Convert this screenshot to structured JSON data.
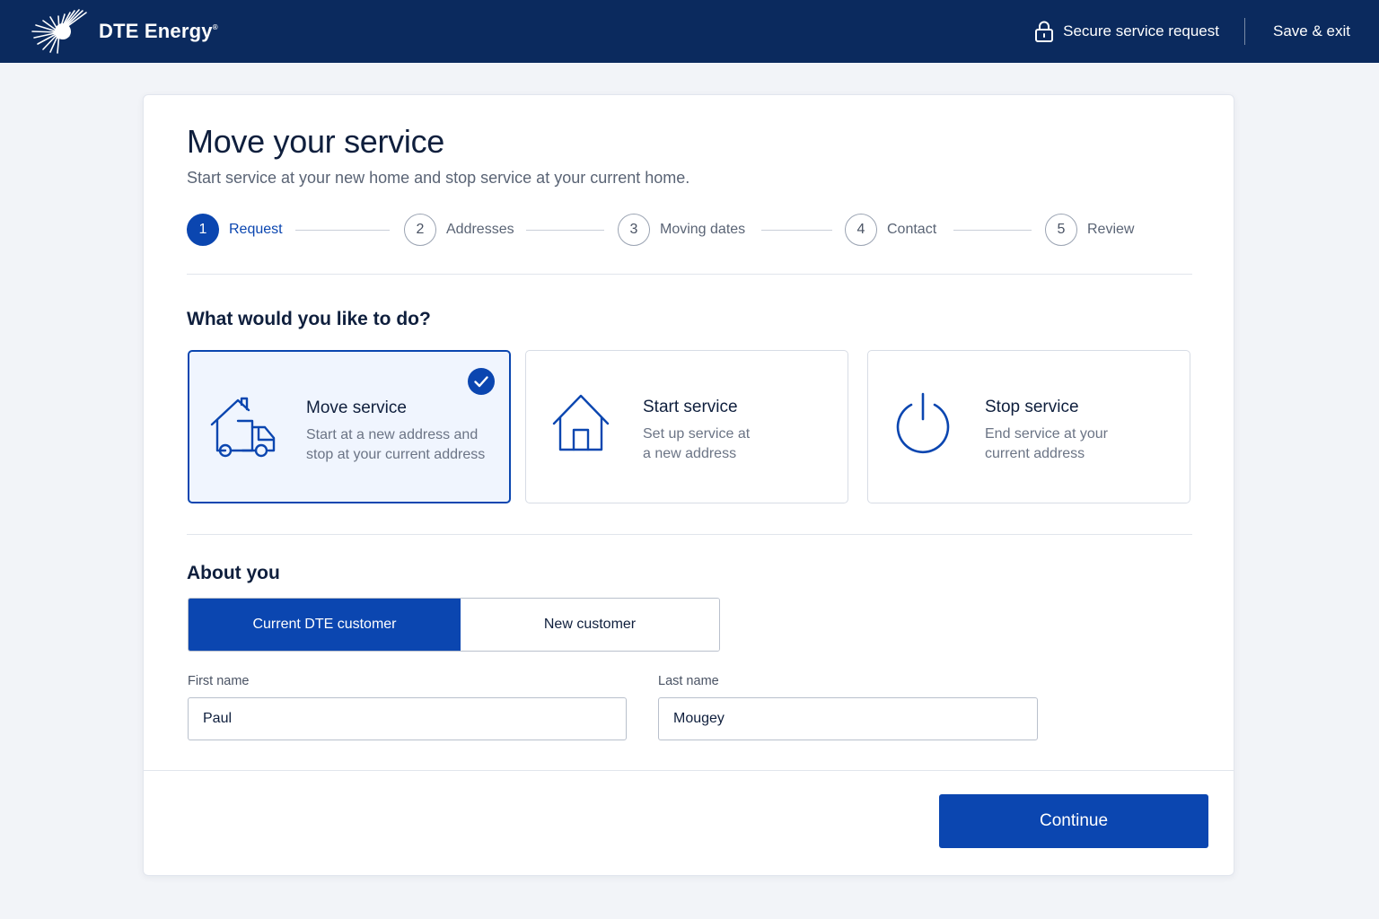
{
  "header": {
    "brand": "DTE Energy",
    "brand_mark": "®",
    "secure_label": "Secure service request",
    "save_exit_label": "Save & exit"
  },
  "page": {
    "title": "Move your service",
    "subtitle": "Start service at your new home and stop service at your current home."
  },
  "stepper": {
    "current_step": 1,
    "steps": [
      {
        "number": "1",
        "label": "Request"
      },
      {
        "number": "2",
        "label": "Addresses"
      },
      {
        "number": "3",
        "label": "Moving dates"
      },
      {
        "number": "4",
        "label": "Contact"
      },
      {
        "number": "5",
        "label": "Review"
      }
    ]
  },
  "request": {
    "question": "What would you like to do?",
    "selected": "Move service",
    "options": [
      {
        "title": "Move service",
        "desc_line1": "Start at a new address and",
        "desc_line2": "stop at your current address",
        "icon": "house-truck-icon"
      },
      {
        "title": "Start service",
        "desc_line1": "Set up service at",
        "desc_line2": "a new address",
        "icon": "house-icon"
      },
      {
        "title": "Stop service",
        "desc_line1": "End service at your",
        "desc_line2": "current address",
        "icon": "power-icon"
      }
    ]
  },
  "about": {
    "heading": "About you",
    "customer_types": [
      "Current DTE customer",
      "New customer"
    ],
    "selected_type": "Current DTE customer",
    "first_name_label": "First name",
    "first_name_value": "Paul",
    "last_name_label": "Last name",
    "last_name_value": "Mougey"
  },
  "footer": {
    "continue_label": "Continue"
  },
  "colors": {
    "header_bg": "#0b2a5e",
    "accent": "#0b46b0",
    "selected_card_bg": "#f0f5fe",
    "page_bg": "#f2f4f8"
  }
}
